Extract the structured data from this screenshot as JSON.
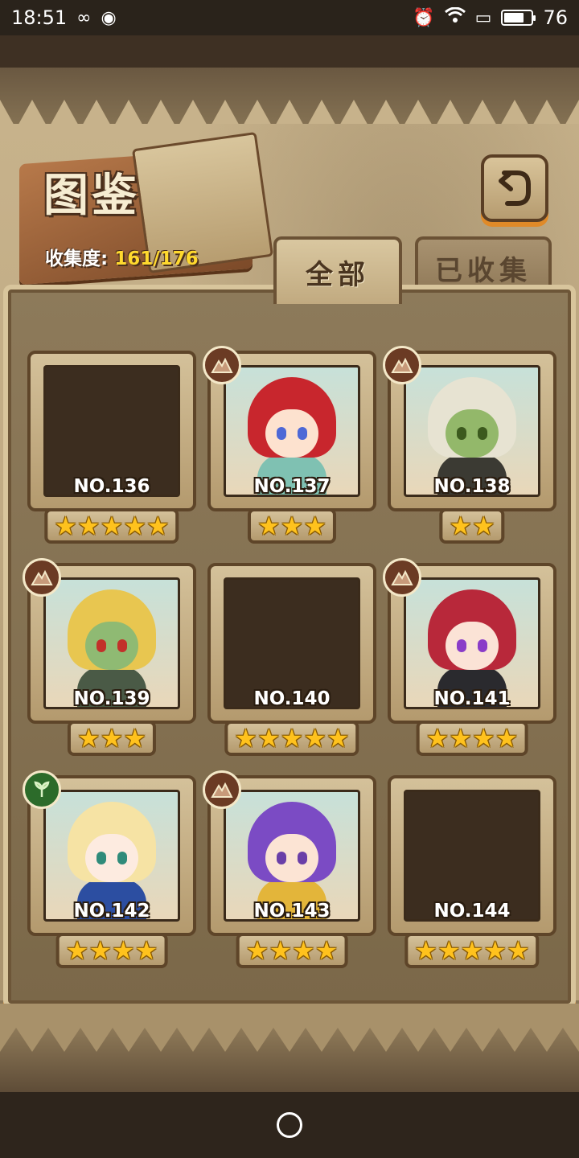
{
  "status_bar": {
    "time": "18:51",
    "battery": "76",
    "battery_level": 0.76,
    "icons": [
      "infinity-icon",
      "drop-icon",
      "alarm-icon",
      "wifi-icon",
      "cast-icon",
      "battery-icon"
    ]
  },
  "header": {
    "title": "图鉴",
    "collect_label": "收集度:",
    "collect_value": "161/176"
  },
  "tabs": [
    {
      "label": "全部",
      "active": true
    },
    {
      "label": "已收集",
      "active": false
    }
  ],
  "cards": [
    {
      "no": "NO.136",
      "stars": "★★★★★",
      "revealed": false,
      "badge": ""
    },
    {
      "no": "NO.137",
      "stars": "★★★",
      "revealed": true,
      "badge": "mountain",
      "hair": "#c8262d",
      "skin": "#fde2cf",
      "eye": "#4e68d6",
      "outfit": "#7fc1b2"
    },
    {
      "no": "NO.138",
      "stars": "★★",
      "revealed": true,
      "badge": "mountain",
      "hair": "#e7e3d2",
      "skin": "#93b86a",
      "eye": "#3c5a1e",
      "outfit": "#3b3a33"
    },
    {
      "no": "NO.139",
      "stars": "★★★",
      "revealed": true,
      "badge": "mountain",
      "hair": "#e8c650",
      "skin": "#8fba73",
      "eye": "#c2302a",
      "outfit": "#4a5a46"
    },
    {
      "no": "NO.140",
      "stars": "★★★★★",
      "revealed": false,
      "badge": ""
    },
    {
      "no": "NO.141",
      "stars": "★★★★",
      "revealed": true,
      "badge": "mountain",
      "hair": "#b8283a",
      "skin": "#fbe3d6",
      "eye": "#8a3cc8",
      "outfit": "#2a2a2e"
    },
    {
      "no": "NO.142",
      "stars": "★★★★",
      "revealed": true,
      "badge": "leaf",
      "hair": "#f6e3a4",
      "skin": "#fdebe0",
      "eye": "#2f8b7a",
      "outfit": "#2c4ea1"
    },
    {
      "no": "NO.143",
      "stars": "★★★★",
      "revealed": true,
      "badge": "mountain",
      "hair": "#7b4bc4",
      "skin": "#fce4d4",
      "eye": "#6a3fa8",
      "outfit": "#e3b53a"
    },
    {
      "no": "NO.144",
      "stars": "★★★★★",
      "revealed": false,
      "badge": ""
    }
  ],
  "colors": {
    "accent_orange": "#e08a28",
    "star_gold": "#ffc21d",
    "frame_dark": "#5e4529"
  }
}
